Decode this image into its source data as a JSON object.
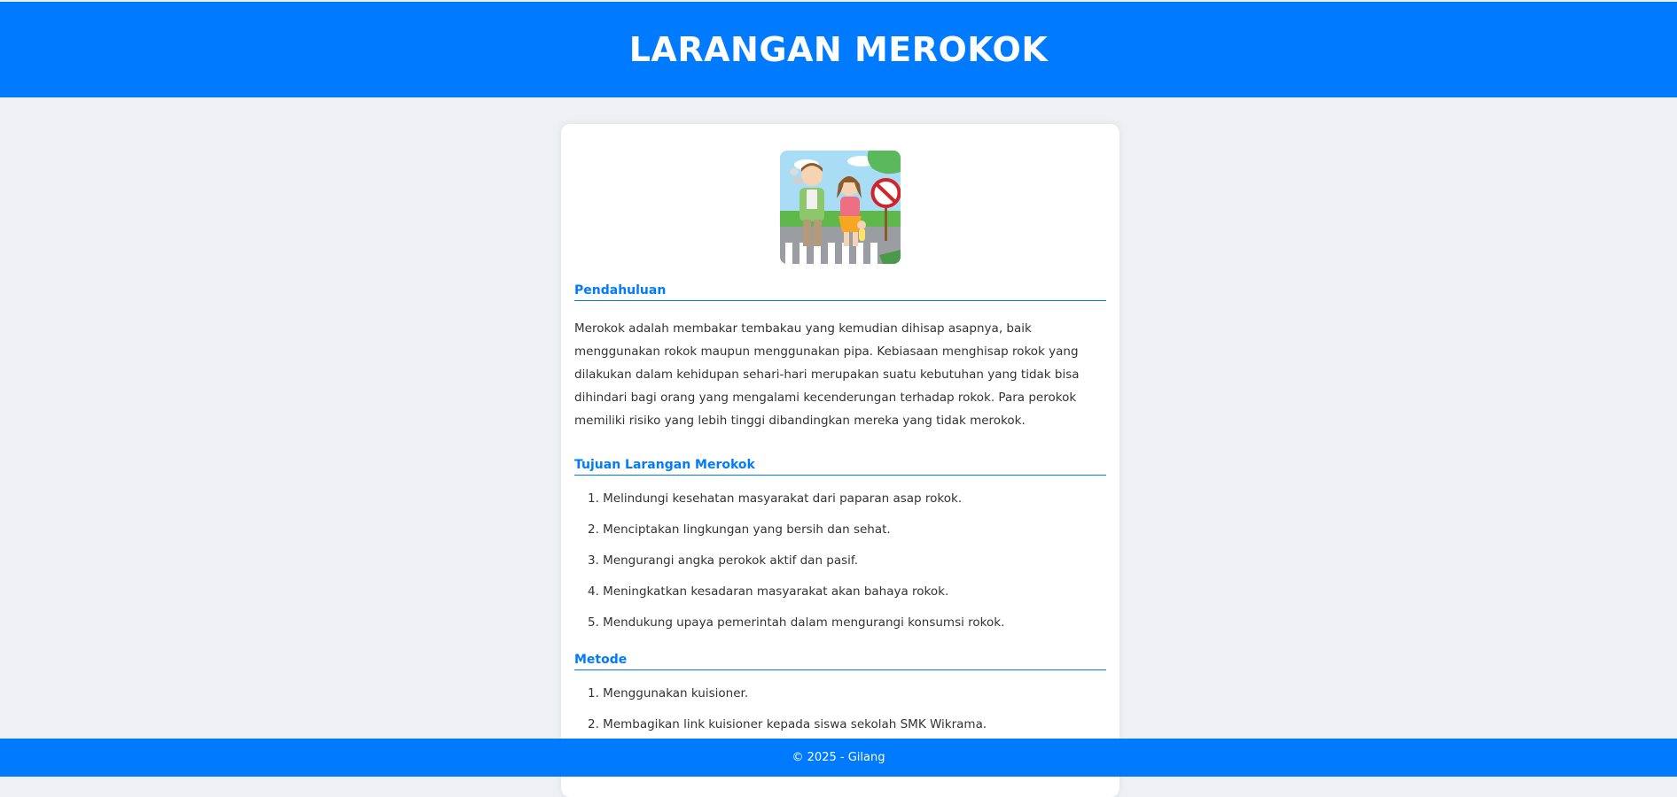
{
  "header": {
    "title": "LARANGAN MEROKOK"
  },
  "intro": {
    "title": "Pendahuluan",
    "text": "Merokok adalah membakar tembakau yang kemudian dihisap asapnya, baik menggunakan rokok maupun menggunakan pipa. Kebiasaan menghisap rokok yang dilakukan dalam kehidupan sehari-hari merupakan suatu kebutuhan yang tidak bisa dihindari bagi orang yang mengalami kecenderungan terhadap rokok. Para perokok memiliki risiko yang lebih tinggi dibandingkan mereka yang tidak merokok."
  },
  "goals": {
    "title": "Tujuan Larangan Merokok",
    "items": [
      "1. Melindungi kesehatan masyarakat dari paparan asap rokok.",
      "2. Menciptakan lingkungan yang bersih dan sehat.",
      "3. Mengurangi angka perokok aktif dan pasif.",
      "4. Meningkatkan kesadaran masyarakat akan bahaya rokok.",
      "5. Mendukung upaya pemerintah dalam mengurangi konsumsi rokok."
    ]
  },
  "method": {
    "title": "Metode",
    "items": [
      "1. Menggunakan kuisioner.",
      "2. Membagikan link kuisioner kepada siswa sekolah SMK Wikrama."
    ]
  },
  "footer": {
    "text": "© 2025 - Gilang"
  },
  "colors": {
    "accent": "#007bff",
    "background": "#eff0f4",
    "card": "#ffffff",
    "text": "#333333"
  }
}
